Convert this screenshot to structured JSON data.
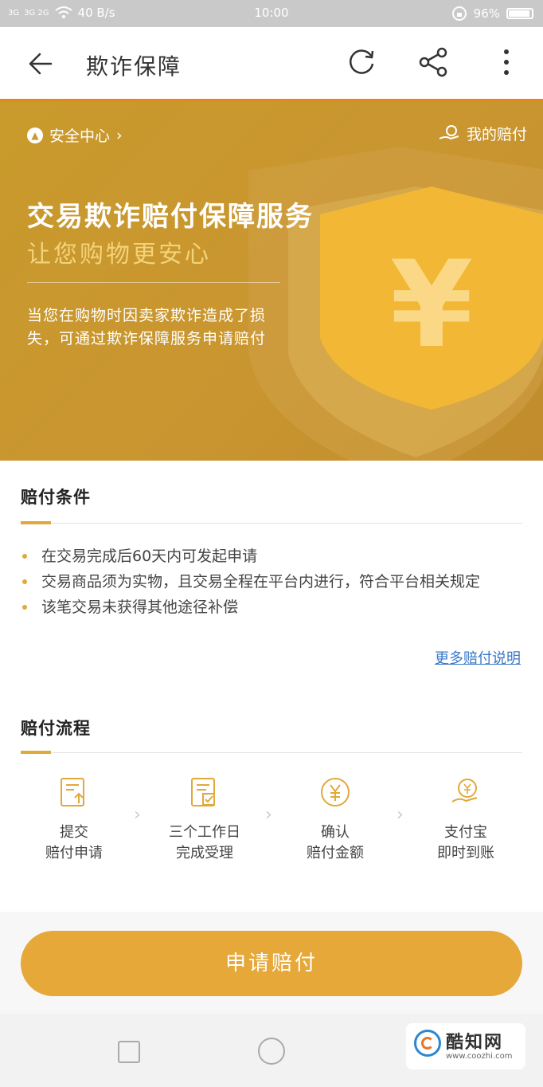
{
  "status_bar": {
    "signal_1": "3G",
    "signal_2": "3G 2G",
    "network_speed": "40 B/s",
    "time": "10:00",
    "battery": "96%"
  },
  "header": {
    "title": "欺诈保障",
    "icons": [
      "back-arrow-icon",
      "refresh-icon",
      "share-icon",
      "more-vert-icon"
    ]
  },
  "banner": {
    "security_center": "安全中心",
    "my_compensation": "我的赔付",
    "headline": "交易欺诈赔付保障服务",
    "subheadline": "让您购物更安心",
    "description": "当您在购物时因卖家欺诈造成了损失，可通过欺诈保障服务申请赔付",
    "shield_symbol": "¥"
  },
  "conditions": {
    "title": "赔付条件",
    "items": [
      "在交易完成后60天内可发起申请",
      "交易商品须为实物，且交易全程在平台内进行，符合平台相关规定",
      "该笔交易未获得其他途径补偿"
    ],
    "more_link": "更多赔付说明"
  },
  "process": {
    "title": "赔付流程",
    "steps": [
      {
        "line1": "提交",
        "line2": "赔付申请",
        "icon": "document-upload-icon"
      },
      {
        "line1": "三个工作日",
        "line2": "完成受理",
        "icon": "document-check-icon"
      },
      {
        "line1": "确认",
        "line2": "赔付金额",
        "icon": "yuan-coin-icon"
      },
      {
        "line1": "支付宝",
        "line2": "即时到账",
        "icon": "hand-coin-icon"
      }
    ]
  },
  "apply_button": "申请赔付",
  "watermark": {
    "name": "酷知网",
    "url": "www.coozhi.com"
  },
  "colors": {
    "accent": "#e5a839",
    "banner": "#c99a2c",
    "link": "#3a78c9"
  }
}
